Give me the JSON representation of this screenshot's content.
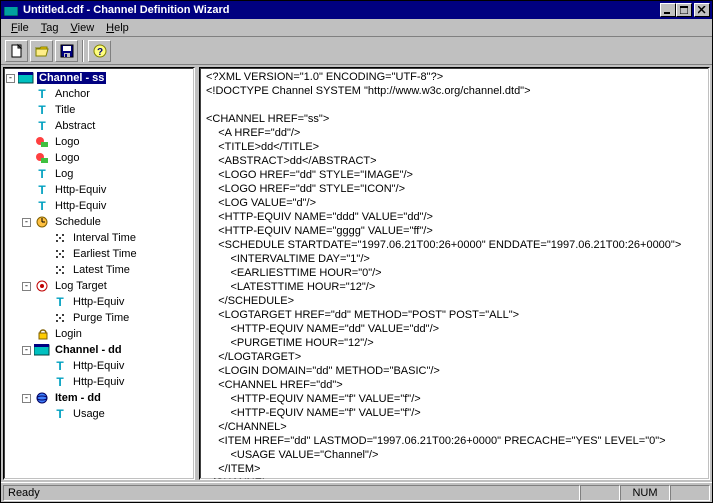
{
  "window": {
    "title": "Untitled.cdf - Channel Definition Wizard"
  },
  "menu": {
    "file": "File",
    "tag": "Tag",
    "view": "View",
    "help": "Help"
  },
  "tree": {
    "root": {
      "label": "Channel - ss"
    },
    "anchor": "Anchor",
    "title": "Title",
    "abstract": "Abstract",
    "logo1": "Logo",
    "logo2": "Logo",
    "log": "Log",
    "httpequiv1": "Http-Equiv",
    "httpequiv2": "Http-Equiv",
    "schedule": "Schedule",
    "interval": "Interval Time",
    "earliest": "Earliest Time",
    "latest": "Latest Time",
    "logtarget": "Log Target",
    "lt_http": "Http-Equiv",
    "lt_purge": "Purge Time",
    "login": "Login",
    "channel_dd": "Channel - dd",
    "cd_http1": "Http-Equiv",
    "cd_http2": "Http-Equiv",
    "item_dd": "Item - dd",
    "usage": "Usage"
  },
  "code": "<?XML VERSION=\"1.0\" ENCODING=\"UTF-8\"?>\n<!DOCTYPE Channel SYSTEM \"http://www.w3c.org/channel.dtd\">\n\n<CHANNEL HREF=\"ss\">\n    <A HREF=\"dd\"/>\n    <TITLE>dd</TITLE>\n    <ABSTRACT>dd</ABSTRACT>\n    <LOGO HREF=\"dd\" STYLE=\"IMAGE\"/>\n    <LOGO HREF=\"dd\" STYLE=\"ICON\"/>\n    <LOG VALUE=\"d\"/>\n    <HTTP-EQUIV NAME=\"ddd\" VALUE=\"dd\"/>\n    <HTTP-EQUIV NAME=\"gggg\" VALUE=\"ff\"/>\n    <SCHEDULE STARTDATE=\"1997.06.21T00:26+0000\" ENDDATE=\"1997.06.21T00:26+0000\">\n        <INTERVALTIME DAY=\"1\"/>\n        <EARLIESTTIME HOUR=\"0\"/>\n        <LATESTTIME HOUR=\"12\"/>\n    </SCHEDULE>\n    <LOGTARGET HREF=\"dd\" METHOD=\"POST\" POST=\"ALL\">\n        <HTTP-EQUIV NAME=\"dd\" VALUE=\"dd\"/>\n        <PURGETIME HOUR=\"12\"/>\n    </LOGTARGET>\n    <LOGIN DOMAIN=\"dd\" METHOD=\"BASIC\"/>\n    <CHANNEL HREF=\"dd\">\n        <HTTP-EQUIV NAME=\"f\" VALUE=\"f\"/>\n        <HTTP-EQUIV NAME=\"f\" VALUE=\"f\"/>\n    </CHANNEL>\n    <ITEM HREF=\"dd\" LASTMOD=\"1997.06.21T00:26+0000\" PRECACHE=\"YES\" LEVEL=\"0\">\n        <USAGE VALUE=\"Channel\"/>\n    </ITEM>\n</CHANNEL>",
  "status": {
    "ready": "Ready",
    "num": "NUM"
  }
}
